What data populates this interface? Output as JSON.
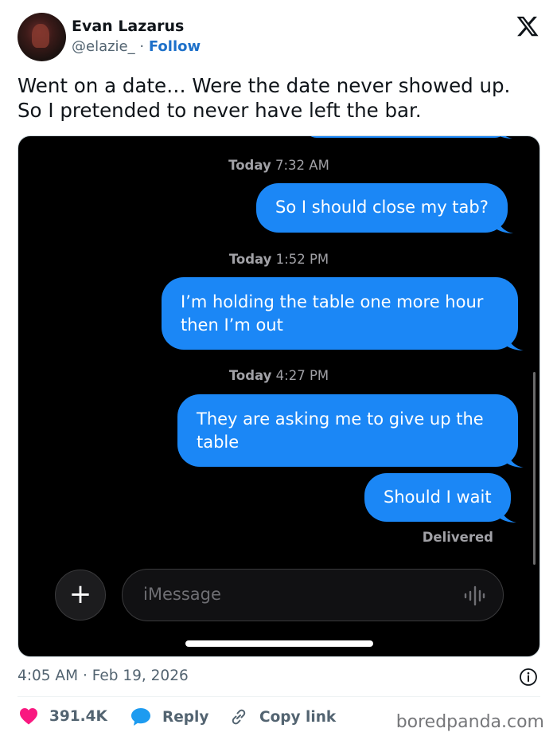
{
  "tweet": {
    "author_name": "Evan Lazarus",
    "handle": "@elazie_",
    "separator": "·",
    "follow_label": "Follow",
    "text_lines": [
      "Went on a date… Were the date never showed up.",
      "So I pretended to never have left the bar."
    ],
    "time": "4:05 AM",
    "date": "Feb 19, 2026",
    "likes": "391.4K",
    "reply_label": "Reply",
    "copy_link_label": "Copy link",
    "brand": "boredpanda.com"
  },
  "messages": {
    "stamps": [
      {
        "day": "Today",
        "time": "7:32 AM"
      },
      {
        "day": "Today",
        "time": "1:52 PM"
      },
      {
        "day": "Today",
        "time": "4:27 PM"
      }
    ],
    "bubbles": [
      {
        "lines": [
          "So I should close my tab?"
        ]
      },
      {
        "lines": [
          "I’m holding the table one more hour",
          "then I’m out"
        ]
      },
      {
        "lines": [
          "They are asking me to give up the",
          "table"
        ]
      },
      {
        "lines": [
          "Should I wait"
        ]
      }
    ],
    "status": "Delivered",
    "input_placeholder": "iMessage",
    "plus_symbol": "+"
  },
  "colors": {
    "bubble_blue": "#1b87f6",
    "like_pink": "#f91880",
    "reply_blue": "#1d9bf0",
    "follow_blue": "#1d70c9"
  },
  "icons": [
    "x-logo-icon",
    "heart-icon",
    "reply-bubble-icon",
    "link-icon",
    "info-icon",
    "plus-icon",
    "audio-wave-icon"
  ]
}
